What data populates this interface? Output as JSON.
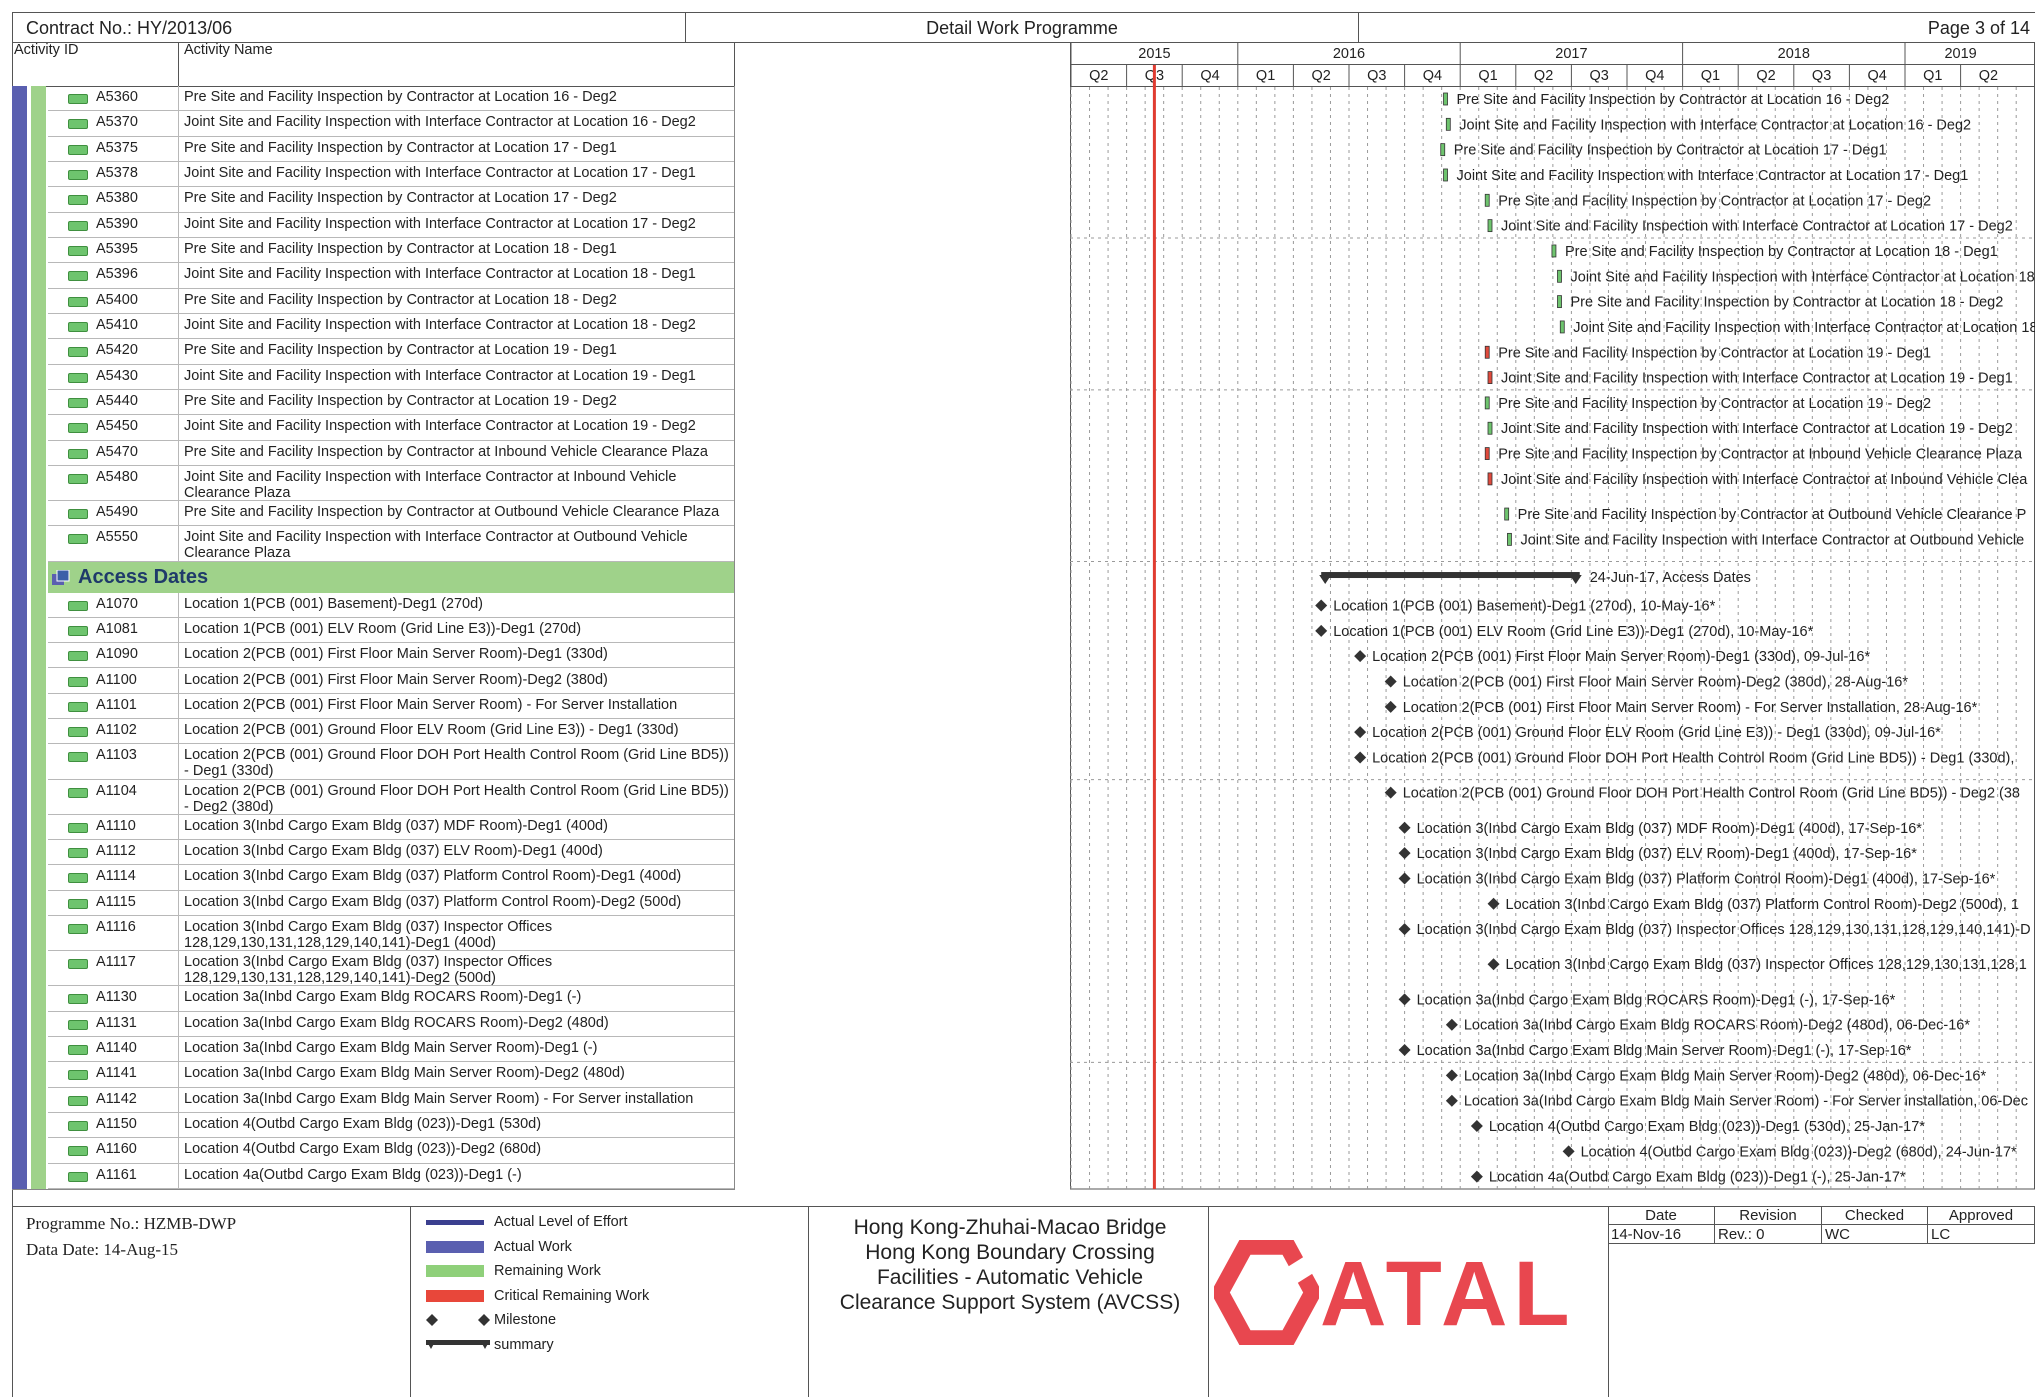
{
  "header": {
    "contract": "Contract No.: HY/2013/06",
    "title": "Detail Work Programme",
    "page": "Page 3 of 14",
    "col_activity_id": "Activity ID",
    "col_activity_name": "Activity Name"
  },
  "timeline": {
    "years": [
      {
        "label": "2015",
        "start": 0,
        "span": 3
      },
      {
        "label": "2016",
        "start": 3,
        "span": 4
      },
      {
        "label": "2017",
        "start": 7,
        "span": 4
      },
      {
        "label": "2018",
        "start": 11,
        "span": 4
      },
      {
        "label": "2019",
        "start": 15,
        "span": 2
      }
    ],
    "quarters": [
      "Q2",
      "Q3",
      "Q4",
      "Q1",
      "Q2",
      "Q3",
      "Q4",
      "Q1",
      "Q2",
      "Q3",
      "Q4",
      "Q1",
      "Q2",
      "Q3",
      "Q4",
      "Q1",
      "Q2"
    ],
    "data_date_quarter_offset": 1.5,
    "data_date_color": "#e03c31"
  },
  "rows": [
    {
      "kind": "act",
      "id": "A5360",
      "name": "Pre Site and Facility Inspection by Contractor at Location 16 - Deg2",
      "bar_q": 6.7,
      "bar_color": "#6ec46e",
      "label": "Pre Site and Facility Inspection by Contractor at Location 16 - Deg2"
    },
    {
      "kind": "act",
      "id": "A5370",
      "name": "Joint Site and Facility Inspection with Interface Contractor at Location 16 - Deg2",
      "bar_q": 6.75,
      "bar_color": "#6ec46e",
      "label": "Joint Site and Facility Inspection with Interface Contractor at Location 16 - Deg2"
    },
    {
      "kind": "act",
      "id": "A5375",
      "name": "Pre Site and Facility Inspection by Contractor at Location 17 - Deg1",
      "bar_q": 6.65,
      "bar_color": "#6ec46e",
      "label": "Pre Site and Facility Inspection by Contractor at Location 17 - Deg1"
    },
    {
      "kind": "act",
      "id": "A5378",
      "name": "Joint Site and Facility Inspection with Interface Contractor at Location 17 - Deg1",
      "bar_q": 6.7,
      "bar_color": "#6ec46e",
      "label": "Joint Site and Facility Inspection with Interface Contractor at Location 17 - Deg1"
    },
    {
      "kind": "act",
      "id": "A5380",
      "name": "Pre Site and Facility Inspection by Contractor at Location 17 - Deg2",
      "bar_q": 7.45,
      "bar_color": "#6ec46e",
      "label": "Pre Site and Facility Inspection by Contractor at Location 17 - Deg2"
    },
    {
      "kind": "act",
      "id": "A5390",
      "name": "Joint Site and Facility Inspection with Interface Contractor at Location 17 - Deg2",
      "bar_q": 7.5,
      "bar_color": "#6ec46e",
      "label": "Joint Site and Facility Inspection with Interface Contractor at Location 17 - Deg2"
    },
    {
      "kind": "act",
      "id": "A5395",
      "name": "Pre Site and Facility Inspection by Contractor at Location 18 - Deg1",
      "bar_q": 8.65,
      "bar_color": "#6ec46e",
      "label": "Pre Site and Facility Inspection by Contractor at Location 18 - Deg1"
    },
    {
      "kind": "act",
      "id": "A5396",
      "name": "Joint Site and Facility Inspection with Interface Contractor at Location 18 - Deg1",
      "bar_q": 8.75,
      "bar_color": "#6ec46e",
      "label": "Joint Site and Facility Inspection with Interface Contractor at Location 18 - Deg1"
    },
    {
      "kind": "act",
      "id": "A5400",
      "name": "Pre Site and Facility Inspection by Contractor at Location 18 - Deg2",
      "bar_q": 8.75,
      "bar_color": "#6ec46e",
      "label": "Pre Site and Facility Inspection by Contractor at Location 18 - Deg2"
    },
    {
      "kind": "act",
      "id": "A5410",
      "name": "Joint Site and Facility Inspection with Interface Contractor at Location 18 - Deg2",
      "bar_q": 8.8,
      "bar_color": "#6ec46e",
      "label": "Joint Site and Facility Inspection with Interface Contractor at Location 18 - Deg2"
    },
    {
      "kind": "act",
      "id": "A5420",
      "name": "Pre Site and Facility Inspection by Contractor at Location 19 - Deg1",
      "bar_q": 7.45,
      "bar_color": "#e04a3c",
      "label": "Pre Site and Facility Inspection by Contractor at Location 19 - Deg1"
    },
    {
      "kind": "act",
      "id": "A5430",
      "name": "Joint Site and Facility Inspection with Interface Contractor at Location 19 - Deg1",
      "bar_q": 7.5,
      "bar_color": "#e04a3c",
      "label": "Joint Site and Facility Inspection with Interface Contractor at Location 19 - Deg1"
    },
    {
      "kind": "act",
      "id": "A5440",
      "name": "Pre Site and Facility Inspection by Contractor at Location 19 - Deg2",
      "bar_q": 7.45,
      "bar_color": "#6ec46e",
      "label": "Pre Site and Facility Inspection by Contractor at Location 19 - Deg2"
    },
    {
      "kind": "act",
      "id": "A5450",
      "name": "Joint Site and Facility Inspection with Interface Contractor at Location 19 - Deg2",
      "bar_q": 7.5,
      "bar_color": "#6ec46e",
      "label": "Joint Site and Facility Inspection with Interface Contractor at Location 19 - Deg2"
    },
    {
      "kind": "act",
      "id": "A5470",
      "name": "Pre Site and Facility Inspection by Contractor at Inbound Vehicle Clearance Plaza",
      "bar_q": 7.45,
      "bar_color": "#e04a3c",
      "label": "Pre Site and Facility Inspection by Contractor at Inbound Vehicle Clearance Plaza"
    },
    {
      "kind": "act",
      "id": "A5480",
      "name": "Joint Site and Facility Inspection with Interface Contractor at Inbound Vehicle Clearance Plaza",
      "bar_q": 7.5,
      "bar_color": "#e04a3c",
      "label": "Joint Site and Facility Inspection with Interface Contractor at Inbound Vehicle Clea"
    },
    {
      "kind": "act",
      "id": "A5490",
      "name": "Pre Site and Facility Inspection by Contractor at Outbound Vehicle Clearance Plaza",
      "bar_q": 7.8,
      "bar_color": "#6ec46e",
      "label": "Pre Site and Facility Inspection by Contractor at Outbound Vehicle Clearance P"
    },
    {
      "kind": "act",
      "id": "A5550",
      "name": "Joint Site and Facility Inspection with Interface Contractor at Outbound Vehicle Clearance Plaza",
      "bar_q": 7.85,
      "bar_color": "#6ec46e",
      "label": "Joint Site and Facility Inspection with Interface Contractor at Outbound Vehicle"
    },
    {
      "kind": "group",
      "name": "Access Dates",
      "sum_start_q": 4.5,
      "sum_end_q": 9.15,
      "label": "24-Jun-17, Access Dates"
    },
    {
      "kind": "ms",
      "id": "A1070",
      "name": "Location 1(PCB (001) Basement)-Deg1 (270d)",
      "ms_q": 4.5,
      "label": "Location 1(PCB (001) Basement)-Deg1 (270d), 10-May-16*"
    },
    {
      "kind": "ms",
      "id": "A1081",
      "name": "Location 1(PCB (001) ELV Room (Grid Line E3))-Deg1 (270d)",
      "ms_q": 4.5,
      "label": "Location 1(PCB (001) ELV Room (Grid Line E3))-Deg1 (270d), 10-May-16*"
    },
    {
      "kind": "ms",
      "id": "A1090",
      "name": "Location 2(PCB (001) First Floor Main Server Room)-Deg1 (330d)",
      "ms_q": 5.2,
      "label": "Location 2(PCB (001) First Floor Main Server Room)-Deg1 (330d), 09-Jul-16*"
    },
    {
      "kind": "ms",
      "id": "A1100",
      "name": "Location 2(PCB (001) First Floor Main Server Room)-Deg2 (380d)",
      "ms_q": 5.75,
      "label": "Location 2(PCB (001) First Floor Main Server Room)-Deg2 (380d), 28-Aug-16*"
    },
    {
      "kind": "ms",
      "id": "A1101",
      "name": "Location 2(PCB (001) First Floor Main Server Room) - For Server Installation",
      "ms_q": 5.75,
      "label": "Location 2(PCB (001) First Floor Main Server Room) - For Server Installation, 28-Aug-16*"
    },
    {
      "kind": "ms",
      "id": "A1102",
      "name": "Location 2(PCB (001) Ground Floor ELV Room (Grid Line E3)) - Deg1 (330d)",
      "ms_q": 5.2,
      "label": "Location 2(PCB (001) Ground Floor ELV Room (Grid Line E3)) - Deg1 (330d), 09-Jul-16*"
    },
    {
      "kind": "ms",
      "id": "A1103",
      "name": "Location 2(PCB (001) Ground Floor DOH Port Health Control Room (Grid Line BD5)) - Deg1 (330d)",
      "ms_q": 5.2,
      "label": "Location 2(PCB (001) Ground Floor DOH Port Health Control Room (Grid Line BD5)) - Deg1 (330d),"
    },
    {
      "kind": "ms",
      "id": "A1104",
      "name": "Location 2(PCB (001) Ground Floor DOH Port Health Control Room (Grid Line BD5)) - Deg2 (380d)",
      "ms_q": 5.75,
      "label": "Location 2(PCB (001) Ground Floor DOH Port Health Control Room (Grid Line BD5)) - Deg2 (38"
    },
    {
      "kind": "ms",
      "id": "A1110",
      "name": "Location 3(Inbd Cargo Exam Bldg (037) MDF Room)-Deg1 (400d)",
      "ms_q": 6.0,
      "label": "Location 3(Inbd Cargo Exam Bldg (037) MDF Room)-Deg1 (400d), 17-Sep-16*"
    },
    {
      "kind": "ms",
      "id": "A1112",
      "name": "Location 3(Inbd Cargo Exam Bldg (037) ELV Room)-Deg1 (400d)",
      "ms_q": 6.0,
      "label": "Location 3(Inbd Cargo Exam Bldg (037) ELV Room)-Deg1 (400d), 17-Sep-16*"
    },
    {
      "kind": "ms",
      "id": "A1114",
      "name": "Location 3(Inbd Cargo Exam Bldg (037) Platform Control Room)-Deg1 (400d)",
      "ms_q": 6.0,
      "label": "Location 3(Inbd Cargo Exam Bldg (037) Platform Control Room)-Deg1 (400d), 17-Sep-16*"
    },
    {
      "kind": "ms",
      "id": "A1115",
      "name": "Location 3(Inbd Cargo Exam Bldg (037) Platform Control Room)-Deg2 (500d)",
      "ms_q": 7.6,
      "label": "Location 3(Inbd Cargo Exam Bldg (037) Platform Control Room)-Deg2 (500d), 1"
    },
    {
      "kind": "ms",
      "id": "A1116",
      "name": "Location 3(Inbd Cargo Exam Bldg (037) Inspector Offices 128,129,130,131,128,129,140,141)-Deg1 (400d)",
      "ms_q": 6.0,
      "label": "Location 3(Inbd Cargo Exam Bldg (037) Inspector Offices 128,129,130,131,128,129,140,141)-D"
    },
    {
      "kind": "ms",
      "id": "A1117",
      "name": "Location 3(Inbd Cargo Exam Bldg (037) Inspector Offices 128,129,130,131,128,129,140,141)-Deg2 (500d)",
      "ms_q": 7.6,
      "label": "Location 3(Inbd Cargo Exam Bldg (037) Inspector Offices 128,129,130,131,128,1"
    },
    {
      "kind": "ms",
      "id": "A1130",
      "name": "Location 3a(Inbd Cargo Exam Bldg ROCARS Room)-Deg1 (-)",
      "ms_q": 6.0,
      "label": "Location 3a(Inbd Cargo Exam Bldg ROCARS Room)-Deg1 (-), 17-Sep-16*"
    },
    {
      "kind": "ms",
      "id": "A1131",
      "name": "Location 3a(Inbd Cargo Exam Bldg ROCARS Room)-Deg2 (480d)",
      "ms_q": 6.85,
      "label": "Location 3a(Inbd Cargo Exam Bldg ROCARS Room)-Deg2 (480d), 06-Dec-16*"
    },
    {
      "kind": "ms",
      "id": "A1140",
      "name": "Location 3a(Inbd Cargo Exam Bldg Main Server Room)-Deg1 (-)",
      "ms_q": 6.0,
      "label": "Location 3a(Inbd Cargo Exam Bldg Main Server Room)-Deg1 (-), 17-Sep-16*"
    },
    {
      "kind": "ms",
      "id": "A1141",
      "name": "Location 3a(Inbd Cargo Exam Bldg Main Server Room)-Deg2 (480d)",
      "ms_q": 6.85,
      "label": "Location 3a(Inbd Cargo Exam Bldg Main Server Room)-Deg2 (480d), 06-Dec-16*"
    },
    {
      "kind": "ms",
      "id": "A1142",
      "name": "Location 3a(Inbd Cargo Exam Bldg Main Server Room) - For Server installation",
      "ms_q": 6.85,
      "label": "Location 3a(Inbd Cargo Exam Bldg Main Server Room) - For Server installation, 06-Dec"
    },
    {
      "kind": "ms",
      "id": "A1150",
      "name": "Location 4(Outbd Cargo Exam Bldg (023))-Deg1 (530d)",
      "ms_q": 7.3,
      "label": "Location 4(Outbd Cargo Exam Bldg (023))-Deg1 (530d), 25-Jan-17*"
    },
    {
      "kind": "ms",
      "id": "A1160",
      "name": "Location 4(Outbd Cargo Exam Bldg (023))-Deg2 (680d)",
      "ms_q": 8.95,
      "label": "Location 4(Outbd Cargo Exam Bldg (023))-Deg2 (680d), 24-Jun-17*"
    },
    {
      "kind": "ms",
      "id": "A1161",
      "name": "Location 4a(Outbd Cargo Exam Bldg (023))-Deg1 (-)",
      "ms_q": 7.3,
      "label": "Location 4a(Outbd Cargo Exam Bldg (023))-Deg1 (-), 25-Jan-17*"
    }
  ],
  "footer": {
    "programme_no": "Programme No.: HZMB-DWP",
    "data_date": "Data Date: 14-Aug-15",
    "legend": [
      {
        "label": "Actual Level of Effort",
        "swatch": "line",
        "color": "#3b3f8f"
      },
      {
        "label": "Actual Work",
        "swatch": "bar",
        "color": "#5a5fb0"
      },
      {
        "label": "Remaining Work",
        "swatch": "bar",
        "color": "#8fd07a"
      },
      {
        "label": "Critical Remaining Work",
        "swatch": "bar",
        "color": "#e8473a"
      },
      {
        "label": "Milestone",
        "swatch": "milestone",
        "color": "#333333"
      },
      {
        "label": "summary",
        "swatch": "summary",
        "color": "#333333"
      }
    ],
    "project": [
      "Hong Kong-Zhuhai-Macao Bridge",
      "Hong Kong Boundary Crossing",
      "Facilities - Automatic Vehicle",
      "Clearance Support System (AVCSS)"
    ],
    "logo_text": "ATAL",
    "logo_color": "#e8474f",
    "approval": {
      "headers": [
        "Date",
        "Revision",
        "Checked",
        "Approved"
      ],
      "values": [
        "14-Nov-16",
        "Rev.: 0",
        "WC",
        "LC"
      ]
    }
  }
}
